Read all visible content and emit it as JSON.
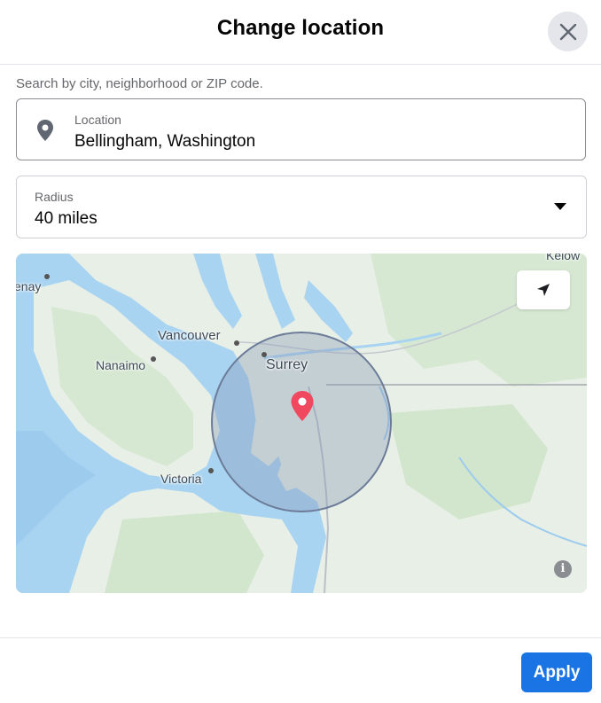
{
  "dialog": {
    "title": "Change location",
    "close_icon": "close-icon"
  },
  "search": {
    "hint": "Search by city, neighborhood or ZIP code."
  },
  "location": {
    "label": "Location",
    "value": "Bellingham, Washington",
    "icon": "map-pin-icon"
  },
  "radius": {
    "label": "Radius",
    "value": "40 miles",
    "icon": "caret-down-icon"
  },
  "map": {
    "labels": {
      "vancouver": "Vancouver",
      "surrey": "Surrey",
      "nanaimo": "Nanaimo",
      "victoria": "Victoria",
      "kelowna_partial": "Kelow",
      "left_partial": "enay"
    },
    "locate_icon": "navigation-arrow-icon",
    "info_icon": "info-icon",
    "info_glyph": "i",
    "colors": {
      "water": "#a8d4f2",
      "land": "#e8efe6",
      "forest": "#d3e6cf",
      "radius_fill": "#8a9bb8",
      "pin": "#f0485e"
    }
  },
  "footer": {
    "apply_label": "Apply",
    "accent": "#1b74e4"
  }
}
